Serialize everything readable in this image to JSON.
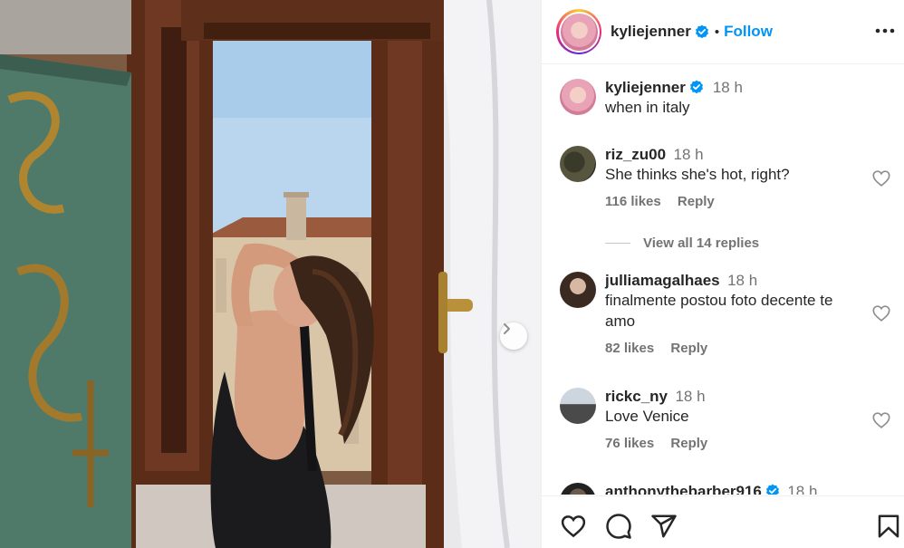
{
  "post": {
    "author": "kyliejenner",
    "verified": true,
    "follow_label": "Follow",
    "separator": "•"
  },
  "caption": {
    "username": "kyliejenner",
    "time": "18 h",
    "text": "when in italy"
  },
  "comments": [
    {
      "username": "riz_zu00",
      "time": "18 h",
      "text": "She thinks she's hot, right?",
      "likes": "116 likes",
      "reply": "Reply"
    },
    {
      "username": "julliamagalhaes",
      "time": "18 h",
      "text": "finalmente postou foto decente te amo",
      "likes": "82 likes",
      "reply": "Reply"
    },
    {
      "username": "rickc_ny",
      "time": "18 h",
      "text": "Love Venice",
      "likes": "76 likes",
      "reply": "Reply"
    },
    {
      "username": "anthonythebarber916",
      "time": "18 h",
      "verified": true
    }
  ],
  "view_replies": "View all 14 replies",
  "icons": {
    "more": "more-horizontal-icon",
    "next": "chevron-right-icon",
    "like": "heart-icon",
    "comment": "comment-icon",
    "share": "send-icon",
    "save": "bookmark-icon"
  },
  "colors": {
    "follow": "#0095f6",
    "verified": "#0095f6",
    "secondary_text": "#737373"
  }
}
